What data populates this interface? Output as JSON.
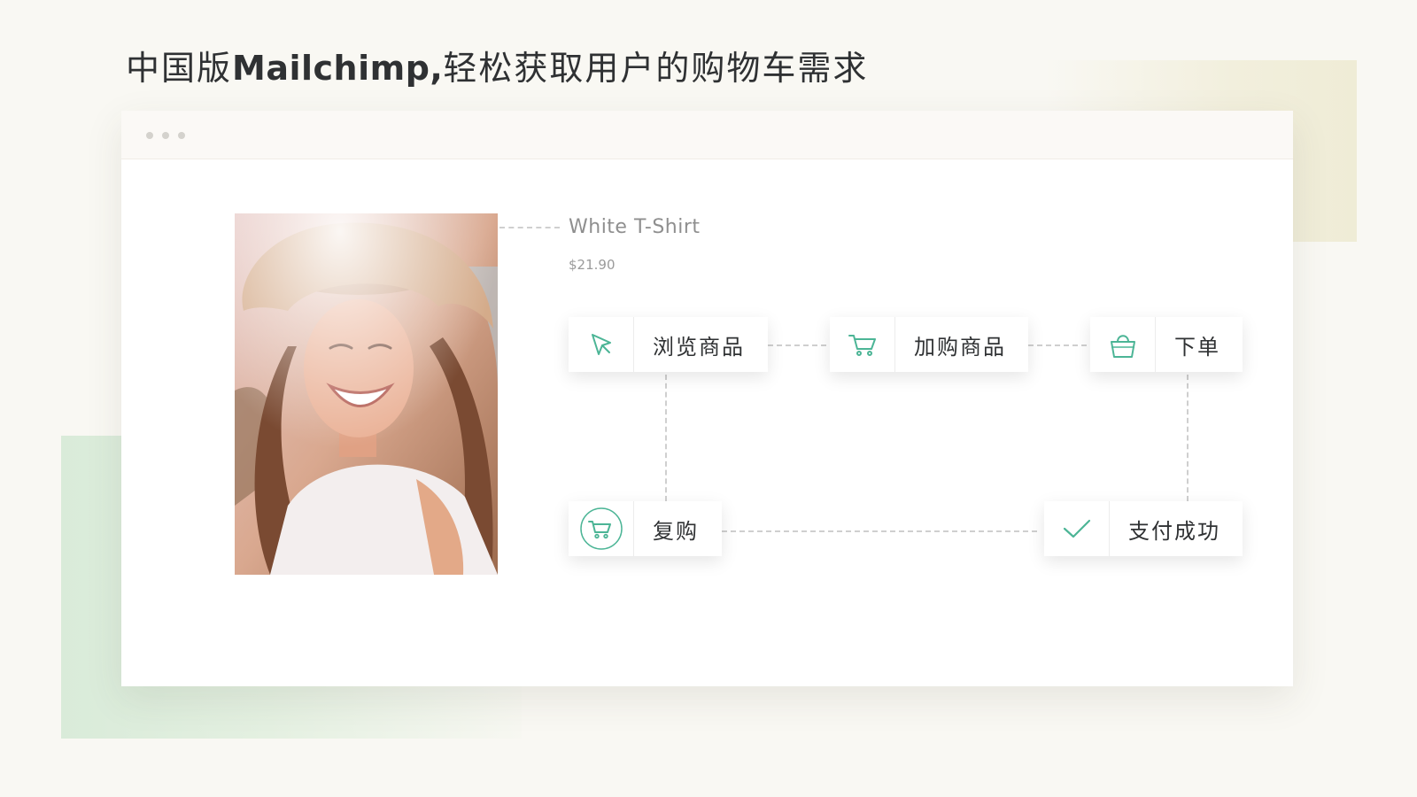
{
  "headline": {
    "prefix": "中国版",
    "brand": "Mailchimp,",
    "suffix": "轻松获取用户的购物车需求"
  },
  "product": {
    "name": "White T-Shirt",
    "price": "$21.90"
  },
  "steps": [
    {
      "label": "浏览商品",
      "icon": "cursor-icon"
    },
    {
      "label": "加购商品",
      "icon": "cart-icon"
    },
    {
      "label": "下单",
      "icon": "shopping-bag-icon"
    },
    {
      "label": "复购",
      "icon": "cart-circle-icon"
    },
    {
      "label": "支付成功",
      "icon": "checkmark-icon"
    }
  ],
  "colors": {
    "accent": "#4cb596",
    "background": "#f9f8f3",
    "text": "#2f3133"
  }
}
